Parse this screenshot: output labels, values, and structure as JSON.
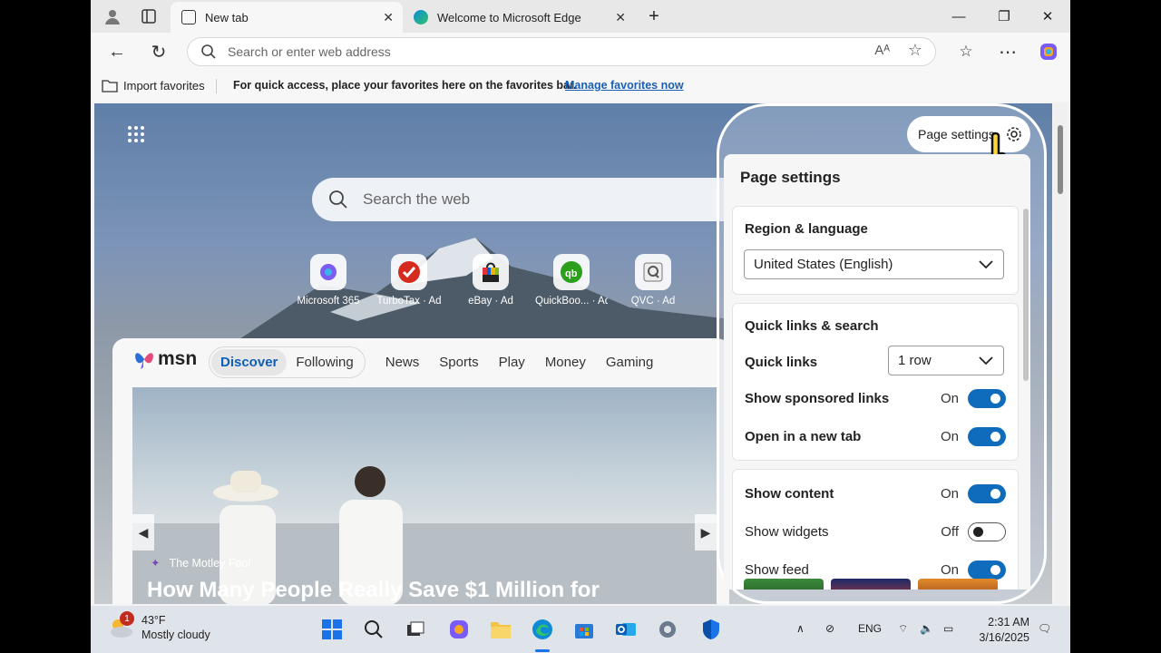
{
  "browser": {
    "tabs": [
      {
        "label": "New tab",
        "active": true
      },
      {
        "label": "Welcome to Microsoft Edge",
        "active": false
      }
    ],
    "address_placeholder": "Search or enter web address"
  },
  "favorites_bar": {
    "import_label": "Import favorites",
    "message": "For quick access, place your favorites here on the favorites bar.",
    "manage_link": "Manage favorites now"
  },
  "newtab": {
    "search_placeholder": "Search the web",
    "quick_links": [
      {
        "label": "Microsoft 365",
        "icon": "microsoft-365-icon"
      },
      {
        "label": "TurboTax · Ad",
        "icon": "turbotax-icon"
      },
      {
        "label": "eBay · Ad",
        "icon": "ebay-icon"
      },
      {
        "label": "QuickBoo... · Ad",
        "icon": "quickbooks-icon"
      },
      {
        "label": "QVC · Ad",
        "icon": "qvc-icon"
      }
    ],
    "feed": {
      "logo": "msn",
      "pill_tabs": [
        "Discover",
        "Following"
      ],
      "tabs": [
        "News",
        "Sports",
        "Play",
        "Money",
        "Gaming"
      ],
      "hero": {
        "source": "The Motley Fool",
        "headline": "How Many People Really Save $1 Million for"
      }
    }
  },
  "settings": {
    "button_label": "Page settings",
    "title": "Page settings",
    "region": {
      "title": "Region & language",
      "selected": "United States (English)"
    },
    "quick_links": {
      "title": "Quick links & search",
      "quick_links_label": "Quick links",
      "quick_links_value": "1 row",
      "sponsored_label": "Show sponsored links",
      "sponsored_value": "On",
      "newtab_label": "Open in a new tab",
      "newtab_value": "On"
    },
    "content": {
      "show_content_label": "Show content",
      "show_content_value": "On",
      "widgets_label": "Show widgets",
      "widgets_value": "Off",
      "feed_label": "Show feed",
      "feed_value": "On"
    }
  },
  "taskbar": {
    "weather_temp": "43°F",
    "weather_desc": "Mostly cloudy",
    "weather_badge": "1",
    "language": "ENG",
    "time": "2:31 AM",
    "date": "3/16/2025"
  },
  "colors": {
    "accent": "#0f6cbd",
    "link": "#1a5fb4"
  }
}
